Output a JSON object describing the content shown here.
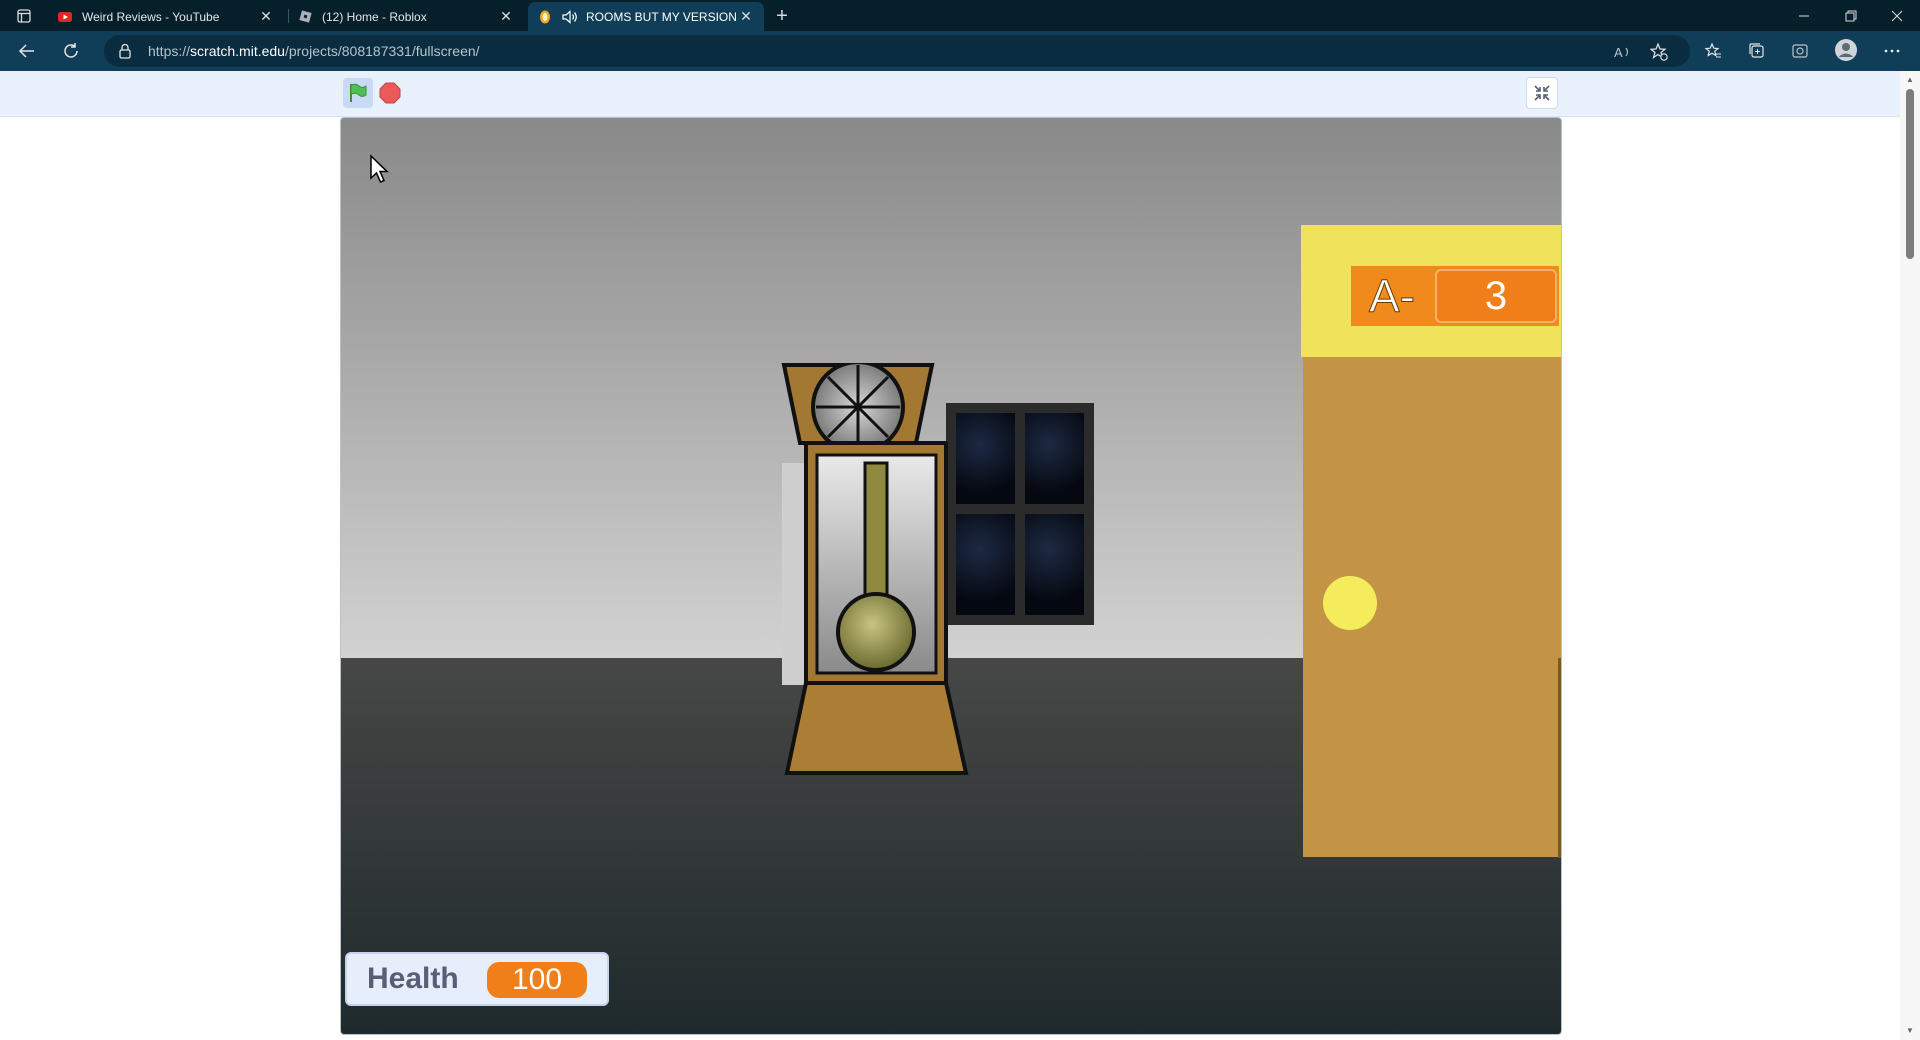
{
  "browser": {
    "tabs": [
      {
        "title": "Weird Reviews - YouTube",
        "icon": "youtube-icon"
      },
      {
        "title": "(12) Home - Roblox",
        "icon": "roblox-icon"
      },
      {
        "title": "ROOMS BUT MY VERSION (",
        "icon": "scratch-icon",
        "active": true
      }
    ],
    "url_prefix": "https://",
    "url_host": "scratch.mit.edu",
    "url_path": "/projects/808187331/fullscreen/"
  },
  "game": {
    "room_label": "A-",
    "room_value": "3",
    "health_label": "Health",
    "health_value": "100"
  },
  "colors": {
    "door": "#c39346",
    "door_top": "#f1e25b",
    "monitor_orange": "#f08a1c",
    "browser_chrome": "#103d57"
  }
}
